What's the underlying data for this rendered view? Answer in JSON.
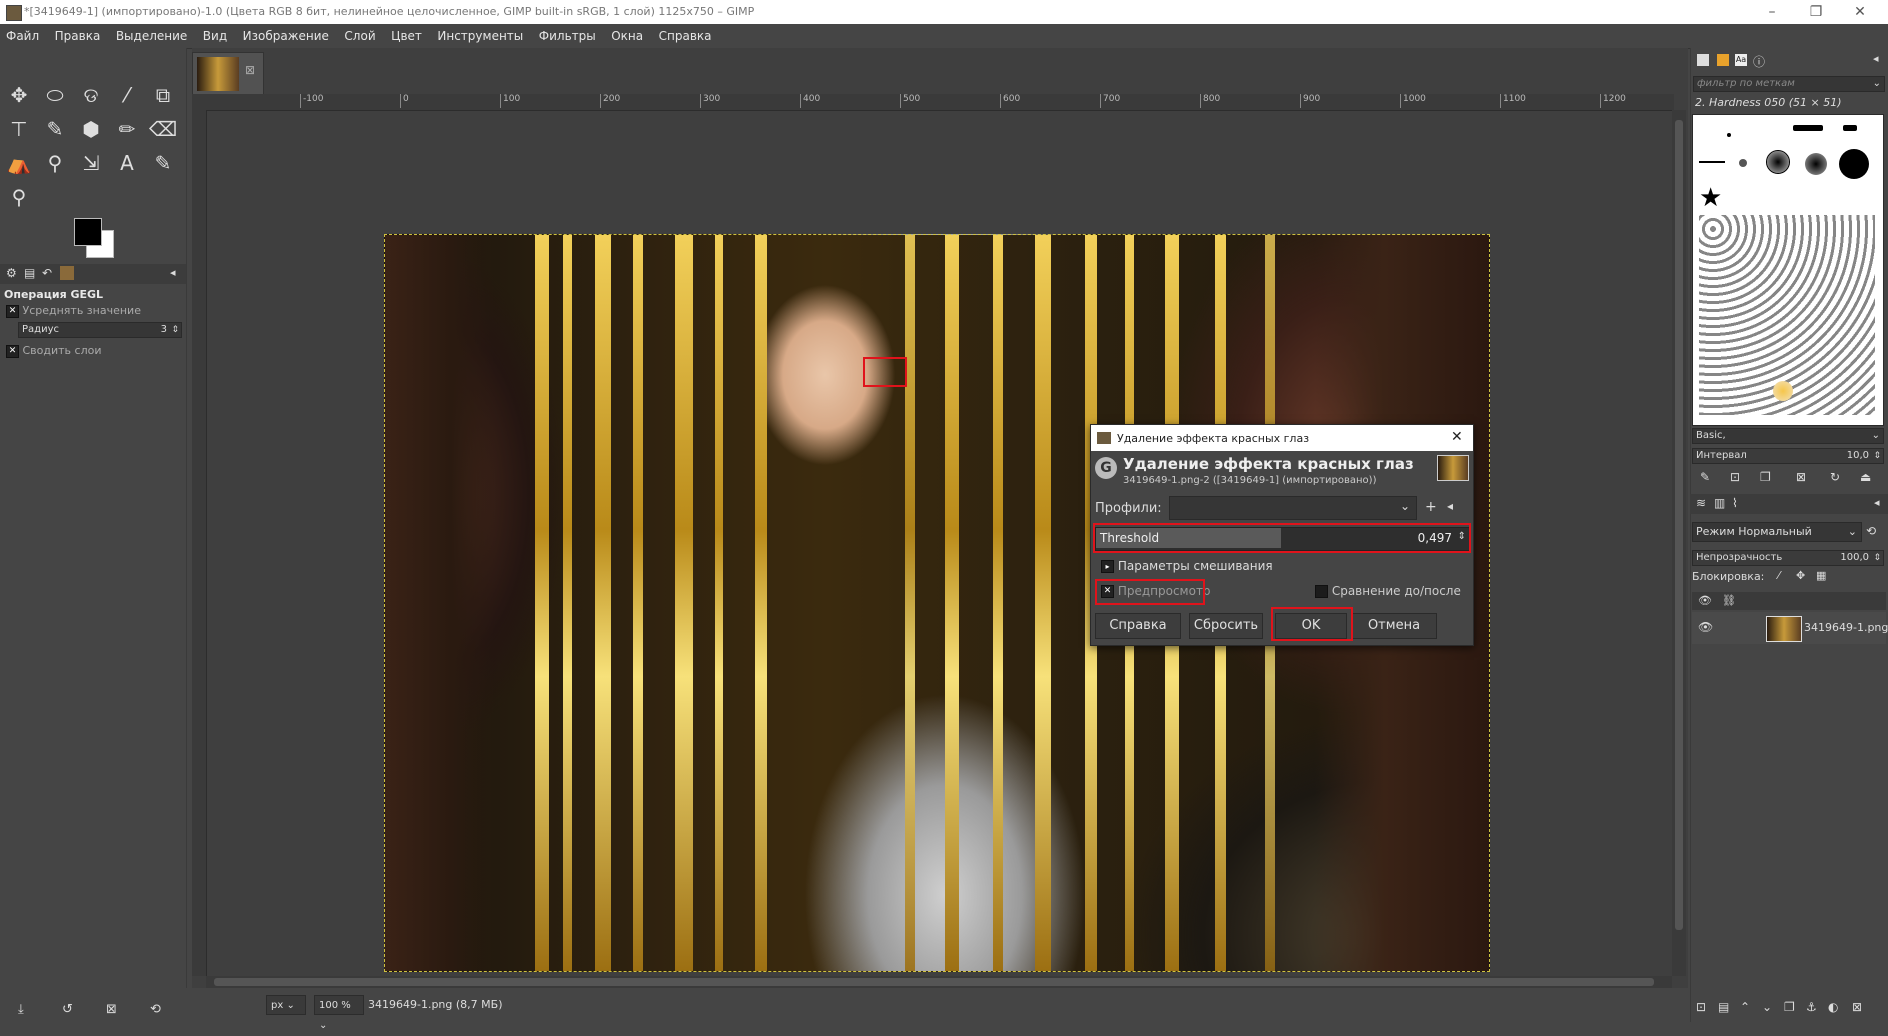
{
  "window": {
    "title": "*[3419649-1] (импортировано)-1.0 (Цвета RGB 8 бит, нелинейное целочисленное, GIMP built-in sRGB, 1 слой) 1125x750 – GIMP",
    "controls": [
      "–",
      "❐",
      "✕"
    ]
  },
  "menubar": [
    "Файл",
    "Правка",
    "Выделение",
    "Вид",
    "Изображение",
    "Слой",
    "Цвет",
    "Инструменты",
    "Фильтры",
    "Окна",
    "Справка"
  ],
  "tools": [
    "✥",
    "⬭",
    "ଡ",
    "⁄",
    "⧉",
    "⊤",
    "✎",
    "⬢",
    "✏",
    "⌫",
    "⛺",
    "⚲",
    "⇲",
    "A",
    "✎",
    "⚲"
  ],
  "tool_options": {
    "header": "Операция GEGL",
    "average_label": "Усреднять значение",
    "radius_label": "Радиус",
    "radius_value": "3",
    "merge_label": "Сводить слои"
  },
  "ruler": {
    "labels": [
      "-100",
      "0",
      "100",
      "200",
      "300",
      "400",
      "500",
      "600",
      "700",
      "800",
      "900",
      "1000",
      "1100",
      "1200"
    ]
  },
  "statusbar": {
    "unit": "px",
    "zoom": "100 %",
    "file": "3419649-1.png (8,7 МБ)"
  },
  "right_dock": {
    "filter_placeholder": "фильтр по меткам",
    "brush_name": "2. Hardness 050 (51 × 51)",
    "brush_tag": "Basic,",
    "interval_label": "Интервал",
    "interval_value": "10,0",
    "mode_label": "Режим",
    "mode_value": "Нормальный",
    "opacity_label": "Непрозрачность",
    "opacity_value": "100,0",
    "lock_label": "Блокировка:",
    "layer_name": "3419649-1.png"
  },
  "dialog": {
    "window_title": "Удаление эффекта красных глаз",
    "heading": "Удаление эффекта красных глаз",
    "subheading": "3419649-1.png-2 ([3419649-1] (импортировано))",
    "profiles_label": "Профили:",
    "threshold_label": "Threshold",
    "threshold_value": "0,497",
    "threshold_fraction": 0.497,
    "blend_label": "Параметры смешивания",
    "preview_label": "Предпросмотр",
    "compare_label": "Сравнение до/после",
    "help_button": "Справка",
    "reset_button": "Сбросить",
    "ok_button": "OK",
    "cancel_button": "Отмена"
  }
}
